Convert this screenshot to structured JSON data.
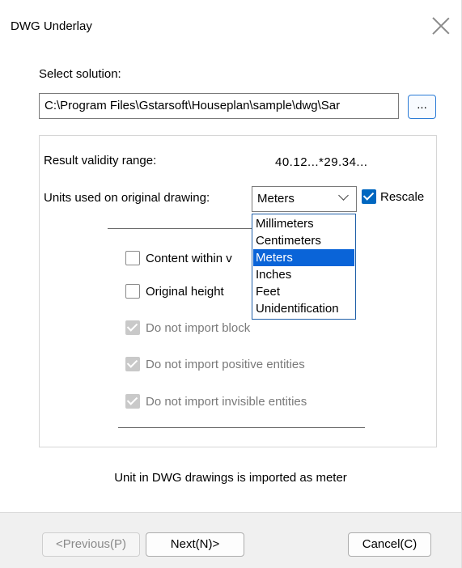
{
  "window": {
    "title": "DWG Underlay"
  },
  "solution": {
    "label": "Select solution:",
    "path": "C:\\Program Files\\Gstarsoft\\Houseplan\\sample\\dwg\\Sar",
    "browse_label": "..."
  },
  "validity": {
    "label": "Result validity range:",
    "value": "40.12...*29.34..."
  },
  "units": {
    "label": "Units used on original drawing:",
    "selected": "Meters",
    "options": [
      "Millimeters",
      "Centimeters",
      "Meters",
      "Inches",
      "Feet",
      "Unidentification"
    ],
    "rescale_label": "Rescale"
  },
  "options": {
    "content_within": "Content within v",
    "original_height": "Original height",
    "no_import_block": "Do not import block",
    "no_import_positive": "Do not import positive entities",
    "no_import_invisible": "Do not import invisible entities"
  },
  "info_text": "Unit in DWG drawings is imported as meter",
  "buttons": {
    "previous": "<Previous(P)",
    "next": "Next(N)>",
    "cancel": "Cancel(C)"
  }
}
